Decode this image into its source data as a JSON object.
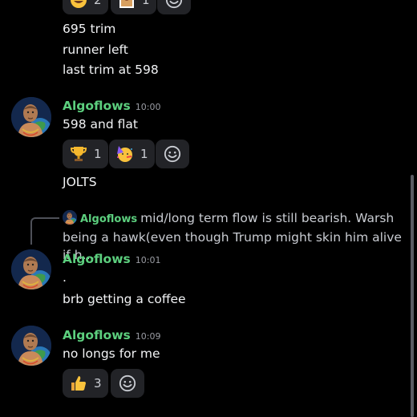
{
  "top_reactions": [
    {
      "emoji": "rolling-laughing-emoji",
      "count": "2"
    },
    {
      "emoji": "image-reaction",
      "count": "1"
    }
  ],
  "first_block": {
    "lines": [
      "695 trim",
      "runner left",
      "last trim at 598"
    ]
  },
  "messages": [
    {
      "author": "Algoflows",
      "time": "10:00",
      "text": "598 and flat",
      "reactions": [
        {
          "emoji": "trophy-emoji",
          "count": "1"
        },
        {
          "emoji": "party-face-emoji",
          "count": "1"
        }
      ],
      "followup": "JOLTS"
    },
    {
      "reply": {
        "author": "Algoflows",
        "text": "mid/long term flow is still bearish. Warsh being a hawk(even though Trump might skin him alive if h…"
      },
      "author": "Algoflows",
      "time": "10:01",
      "text": ".",
      "followup": "brb getting a coffee"
    },
    {
      "author": "Algoflows",
      "time": "10:09",
      "text": "no longs for me",
      "reactions": [
        {
          "emoji": "thumbs-up-emoji",
          "count": "3"
        }
      ]
    }
  ],
  "colors": {
    "background": "#000000",
    "author": "#5ccf7e",
    "reaction_bg": "#222327",
    "timestamp": "#9a9ca3"
  }
}
